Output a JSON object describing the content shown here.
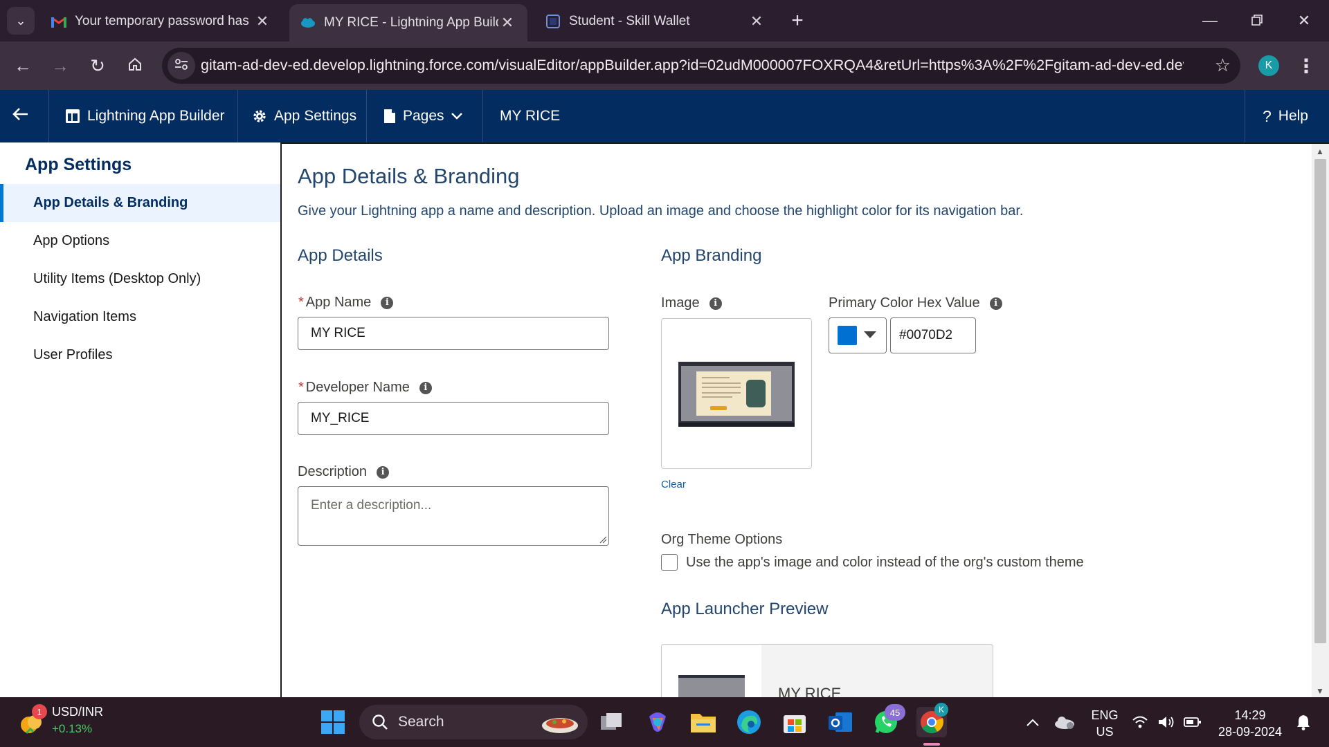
{
  "browser": {
    "tabs": [
      {
        "title": "Your temporary password has b",
        "favicon": "gmail-icon",
        "active": false
      },
      {
        "title": "MY RICE - Lightning App Builde",
        "favicon": "salesforce-cloud-icon",
        "active": true
      },
      {
        "title": "Student - Skill Wallet",
        "favicon": "skill-wallet-icon",
        "active": false
      }
    ],
    "url": "gitam-ad-dev-ed.develop.lightning.force.com/visualEditor/appBuilder.app?id=02udM000007FOXRQA4&retUrl=https%3A%2F%2Fgitam-ad-dev-ed.devel...",
    "profile_initial": "K"
  },
  "sf_header": {
    "back": "back-arrow-icon",
    "app_builder": "Lightning App Builder",
    "app_settings": "App Settings",
    "pages": "Pages",
    "app_name": "MY RICE",
    "help": "Help"
  },
  "settings_nav": {
    "heading": "App Settings",
    "items": [
      {
        "label": "App Details & Branding",
        "selected": true
      },
      {
        "label": "App Options",
        "selected": false
      },
      {
        "label": "Utility Items (Desktop Only)",
        "selected": false
      },
      {
        "label": "Navigation Items",
        "selected": false
      },
      {
        "label": "User Profiles",
        "selected": false
      }
    ]
  },
  "main": {
    "title": "App Details & Branding",
    "description": "Give your Lightning app a name and description. Upload an image and choose the highlight color for its navigation bar.",
    "details": {
      "heading": "App Details",
      "app_name_label": "App Name",
      "app_name_value": "MY RICE",
      "dev_name_label": "Developer Name",
      "dev_name_value": "MY_RICE",
      "description_label": "Description",
      "description_placeholder": "Enter a description..."
    },
    "branding": {
      "heading": "App Branding",
      "image_label": "Image",
      "clear_label": "Clear",
      "color_label": "Primary Color Hex Value",
      "color_value": "#0070D2",
      "org_theme_label": "Org Theme Options",
      "org_theme_checkbox": "Use the app's image and color instead of the org's custom theme",
      "org_theme_checked": false,
      "preview_heading": "App Launcher Preview",
      "preview_name": "MY RICE"
    }
  },
  "taskbar": {
    "widget_title": "USD/INR",
    "widget_change": "+0.13%",
    "widget_badge": "1",
    "search_placeholder": "Search",
    "whatsapp_badge": "45",
    "chrome_badge": "K",
    "lang_line1": "ENG",
    "lang_line2": "US",
    "time": "14:29",
    "date": "28-09-2024"
  },
  "colors": {
    "sf_header": "#032d60",
    "accent": "#0070D2",
    "chrome_frame": "#2b1e2f"
  }
}
